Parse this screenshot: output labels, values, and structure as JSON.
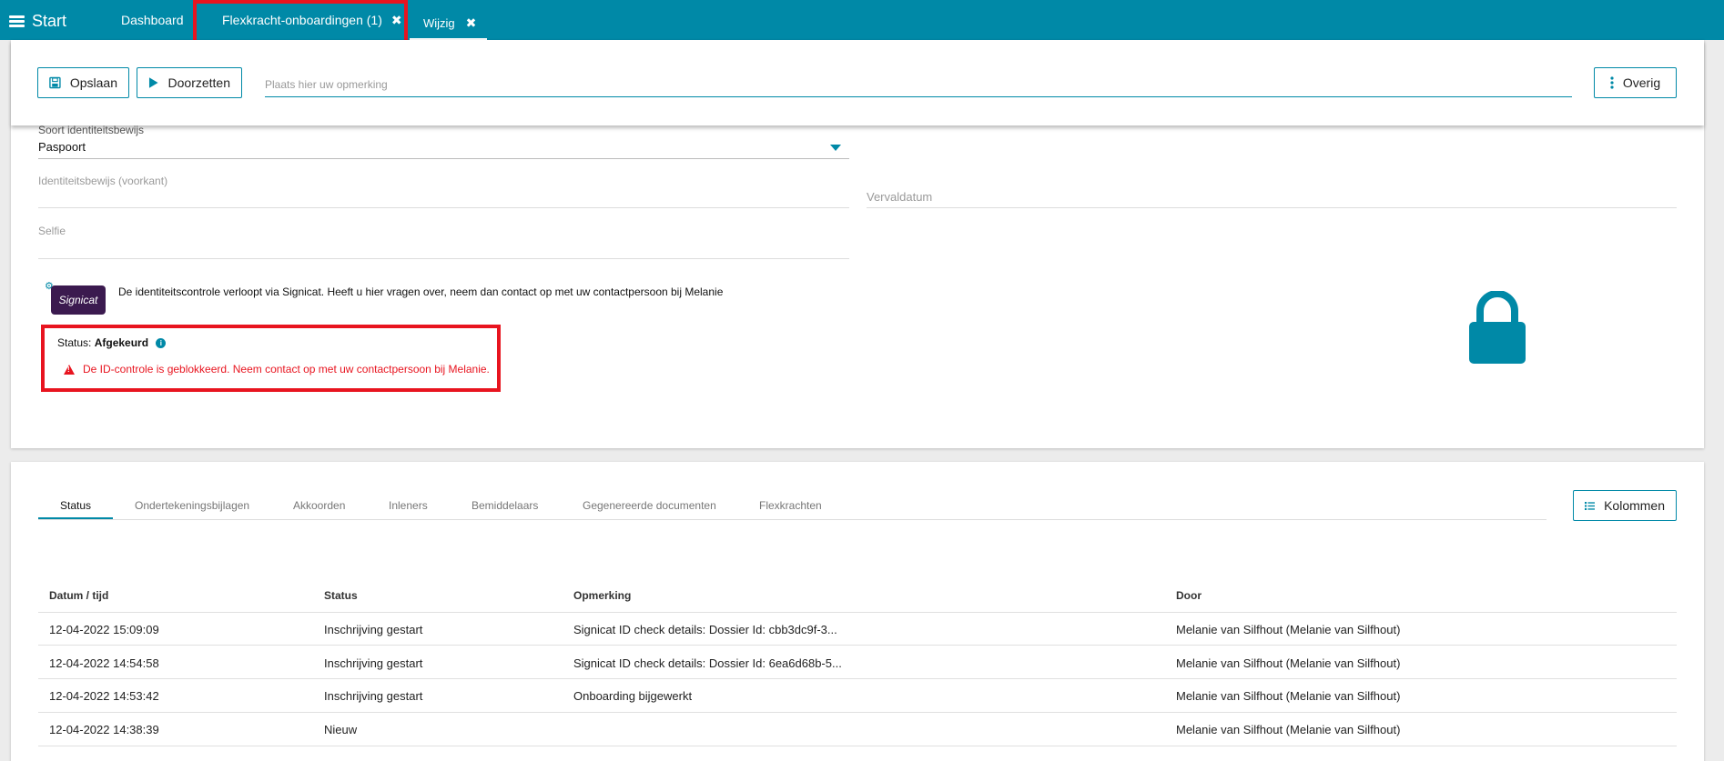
{
  "topbar": {
    "menu_label": "Start",
    "tabs": [
      {
        "label": "Dashboard"
      },
      {
        "label": "Flexkracht-onboardingen (1)",
        "close": "✖"
      },
      {
        "label": "Wijzig",
        "close": "✖"
      }
    ]
  },
  "toolbar": {
    "save_label": "Opslaan",
    "forward_label": "Doorzetten",
    "remark_placeholder": "Plaats hier uw opmerking",
    "more_label": "Overig"
  },
  "form": {
    "id_type_label": "Soort identiteitsbewijs",
    "id_type_value": "Paspoort",
    "id_front_label": "Identiteitsbewijs (voorkant)",
    "selfie_label": "Selfie",
    "expiry_label": "Vervaldatum"
  },
  "signicat": {
    "logo_text": "Signicat",
    "info_text": "De identiteitscontrole verloopt via Signicat. Heeft u hier vragen over, neem dan contact op met uw contactpersoon bij Melanie",
    "status_prefix": "Status:",
    "status_value": "Afgekeurd",
    "error_text": "De ID-controle is geblokkeerd. Neem contact op met uw contactpersoon bij Melanie."
  },
  "bottom": {
    "tabs": [
      "Status",
      "Ondertekeningsbijlagen",
      "Akkoorden",
      "Inleners",
      "Bemiddelaars",
      "Gegenereerde documenten",
      "Flexkrachten"
    ],
    "columns_label": "Kolommen",
    "table": {
      "headers": [
        "Datum / tijd",
        "Status",
        "Opmerking",
        "Door"
      ],
      "rows": [
        [
          "12-04-2022 15:09:09",
          "Inschrijving gestart",
          "Signicat ID check details: Dossier Id: cbb3dc9f-3...",
          "Melanie van Silfhout (Melanie van Silfhout)"
        ],
        [
          "12-04-2022 14:54:58",
          "Inschrijving gestart",
          "Signicat ID check details: Dossier Id: 6ea6d68b-5...",
          "Melanie van Silfhout (Melanie van Silfhout)"
        ],
        [
          "12-04-2022 14:53:42",
          "Inschrijving gestart",
          "Onboarding bijgewerkt",
          "Melanie van Silfhout (Melanie van Silfhout)"
        ],
        [
          "12-04-2022 14:38:39",
          "Nieuw",
          "",
          "Melanie van Silfhout (Melanie van Silfhout)"
        ]
      ]
    }
  },
  "colors": {
    "accent": "#0089a7",
    "highlight": "#e8141f",
    "error": "#e8141f"
  }
}
